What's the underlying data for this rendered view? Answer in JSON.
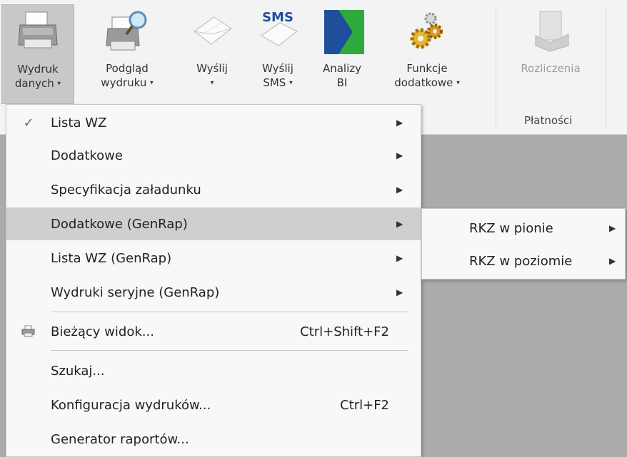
{
  "ribbon": {
    "buttons": [
      {
        "line1": "Wydruk",
        "line2": "danych",
        "caret": "▾",
        "icon": "printer-icon"
      },
      {
        "line1": "Podgląd",
        "line2": "wydruku",
        "caret": "▾",
        "icon": "print-preview-icon"
      },
      {
        "line1": "Wyślij",
        "line2": "",
        "caret": "▾",
        "icon": "envelope-icon"
      },
      {
        "line1": "Wyślij",
        "line2": "SMS",
        "caret": "▾",
        "icon": "sms-envelope-icon",
        "badge": "SMS"
      },
      {
        "line1": "Analizy",
        "line2": "BI",
        "caret": "",
        "icon": "bi-analytics-icon"
      },
      {
        "line1": "Funkcje",
        "line2": "dodatkowe",
        "caret": "▾",
        "icon": "gears-icon"
      },
      {
        "line1": "Rozliczenia",
        "line2": "",
        "caret": "",
        "icon": "settlements-icon"
      }
    ],
    "group_label": "Płatności"
  },
  "menu": {
    "items": [
      {
        "label": "Lista WZ",
        "checked": "✓",
        "arrow": "▶"
      },
      {
        "label": "Dodatkowe",
        "arrow": "▶"
      },
      {
        "label": "Specyfikacja załadunku",
        "arrow": "▶"
      },
      {
        "label": "Dodatkowe (GenRap)",
        "arrow": "▶",
        "highlighted": true
      },
      {
        "label": "Lista WZ (GenRap)",
        "arrow": "▶"
      },
      {
        "label": "Wydruki seryjne (GenRap)",
        "arrow": "▶"
      },
      {
        "label": "Bieżący widok...",
        "shortcut": "Ctrl+Shift+F2",
        "icon": "current-view-printer-icon"
      },
      {
        "label": "Szukaj..."
      },
      {
        "label": "Konfiguracja wydruków...",
        "shortcut": "Ctrl+F2"
      },
      {
        "label": "Generator raportów..."
      }
    ]
  },
  "submenu": {
    "items": [
      {
        "label": "RKZ w pionie",
        "arrow": "▶"
      },
      {
        "label": "RKZ w poziomie",
        "arrow": "▶"
      }
    ]
  },
  "colors": {
    "background": "#ababab",
    "ribbon": "#f3f3f3",
    "menu": "#f8f8f8",
    "highlight": "#cfcfcf",
    "bi_blue": "#1f4e9c",
    "bi_green": "#2eaa3c"
  }
}
